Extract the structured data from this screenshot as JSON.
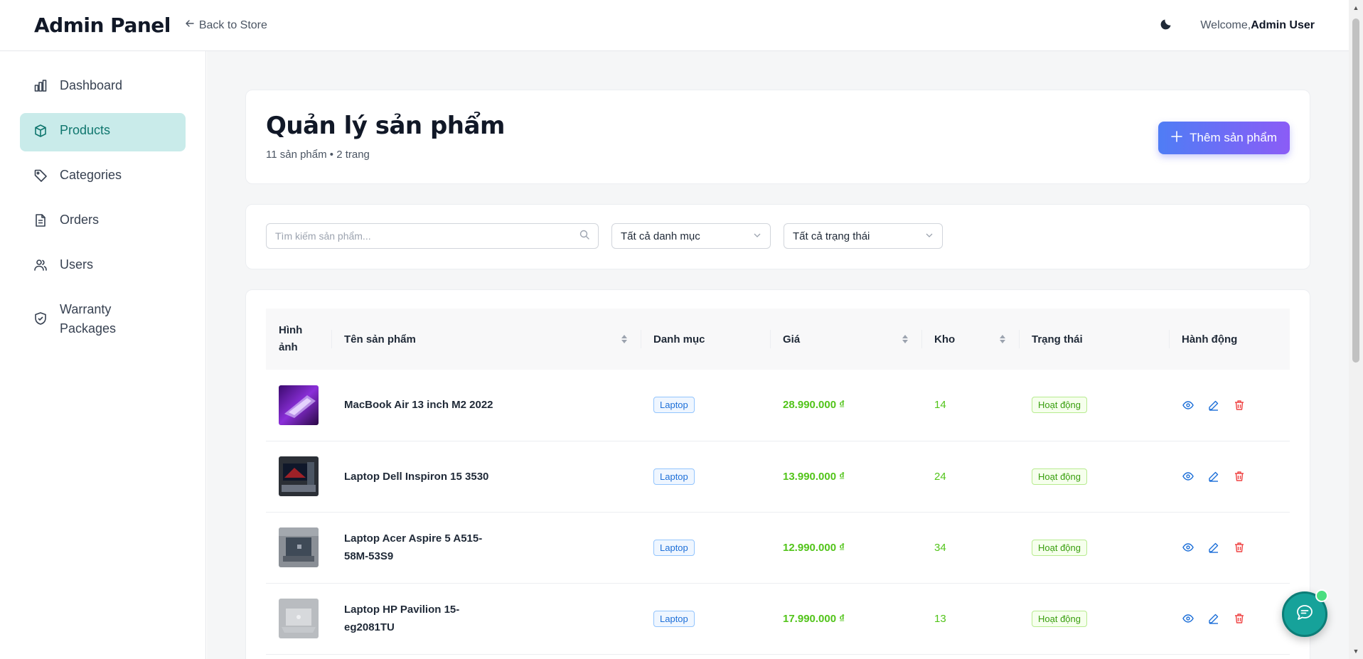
{
  "header": {
    "brand": "Admin Panel",
    "back_link": "Back to Store",
    "welcome_prefix": "Welcome,",
    "user_name": "Admin User"
  },
  "sidebar": {
    "items": [
      {
        "label": "Dashboard",
        "icon": "bar-chart-icon"
      },
      {
        "label": "Products",
        "icon": "box-icon",
        "active": true
      },
      {
        "label": "Categories",
        "icon": "tag-icon"
      },
      {
        "label": "Orders",
        "icon": "file-icon"
      },
      {
        "label": "Users",
        "icon": "users-icon"
      },
      {
        "label": "Warranty Packages",
        "icon": "shield-check-icon"
      }
    ]
  },
  "page": {
    "title": "Quản lý sản phẩm",
    "subtitle": "11 sản phẩm • 2 trang",
    "add_button": "Thêm sản phẩm"
  },
  "filters": {
    "search_placeholder": "Tìm kiếm sản phẩm...",
    "category_select": "Tất cả danh mục",
    "status_select": "Tất cả trạng thái"
  },
  "table": {
    "columns": {
      "image": "Hình ảnh",
      "name": "Tên sản phẩm",
      "category": "Danh mục",
      "price": "Giá",
      "stock": "Kho",
      "status": "Trạng thái",
      "actions": "Hành động"
    },
    "rows": [
      {
        "name": "MacBook Air 13 inch M2 2022",
        "category": "Laptop",
        "price": "28.990.000 ₫",
        "stock": "14",
        "status": "Hoạt động"
      },
      {
        "name": "Laptop Dell Inspiron 15 3530",
        "category": "Laptop",
        "price": "13.990.000 ₫",
        "stock": "24",
        "status": "Hoạt động"
      },
      {
        "name": "Laptop Acer Aspire 5 A515-58M-53S9",
        "category": "Laptop",
        "price": "12.990.000 ₫",
        "stock": "34",
        "status": "Hoạt động"
      },
      {
        "name": "Laptop HP Pavilion 15-eg2081TU",
        "category": "Laptop",
        "price": "17.990.000 ₫",
        "stock": "13",
        "status": "Hoạt động"
      }
    ]
  },
  "colors": {
    "accent_teal": "#0f766e",
    "active_bg": "#c9ebea",
    "price_green": "#52c41a",
    "button_gradient_start": "#4f7df5",
    "button_gradient_end": "#8b5cf6",
    "delete_red": "#ef4444",
    "view_blue": "#1d6fd8"
  }
}
